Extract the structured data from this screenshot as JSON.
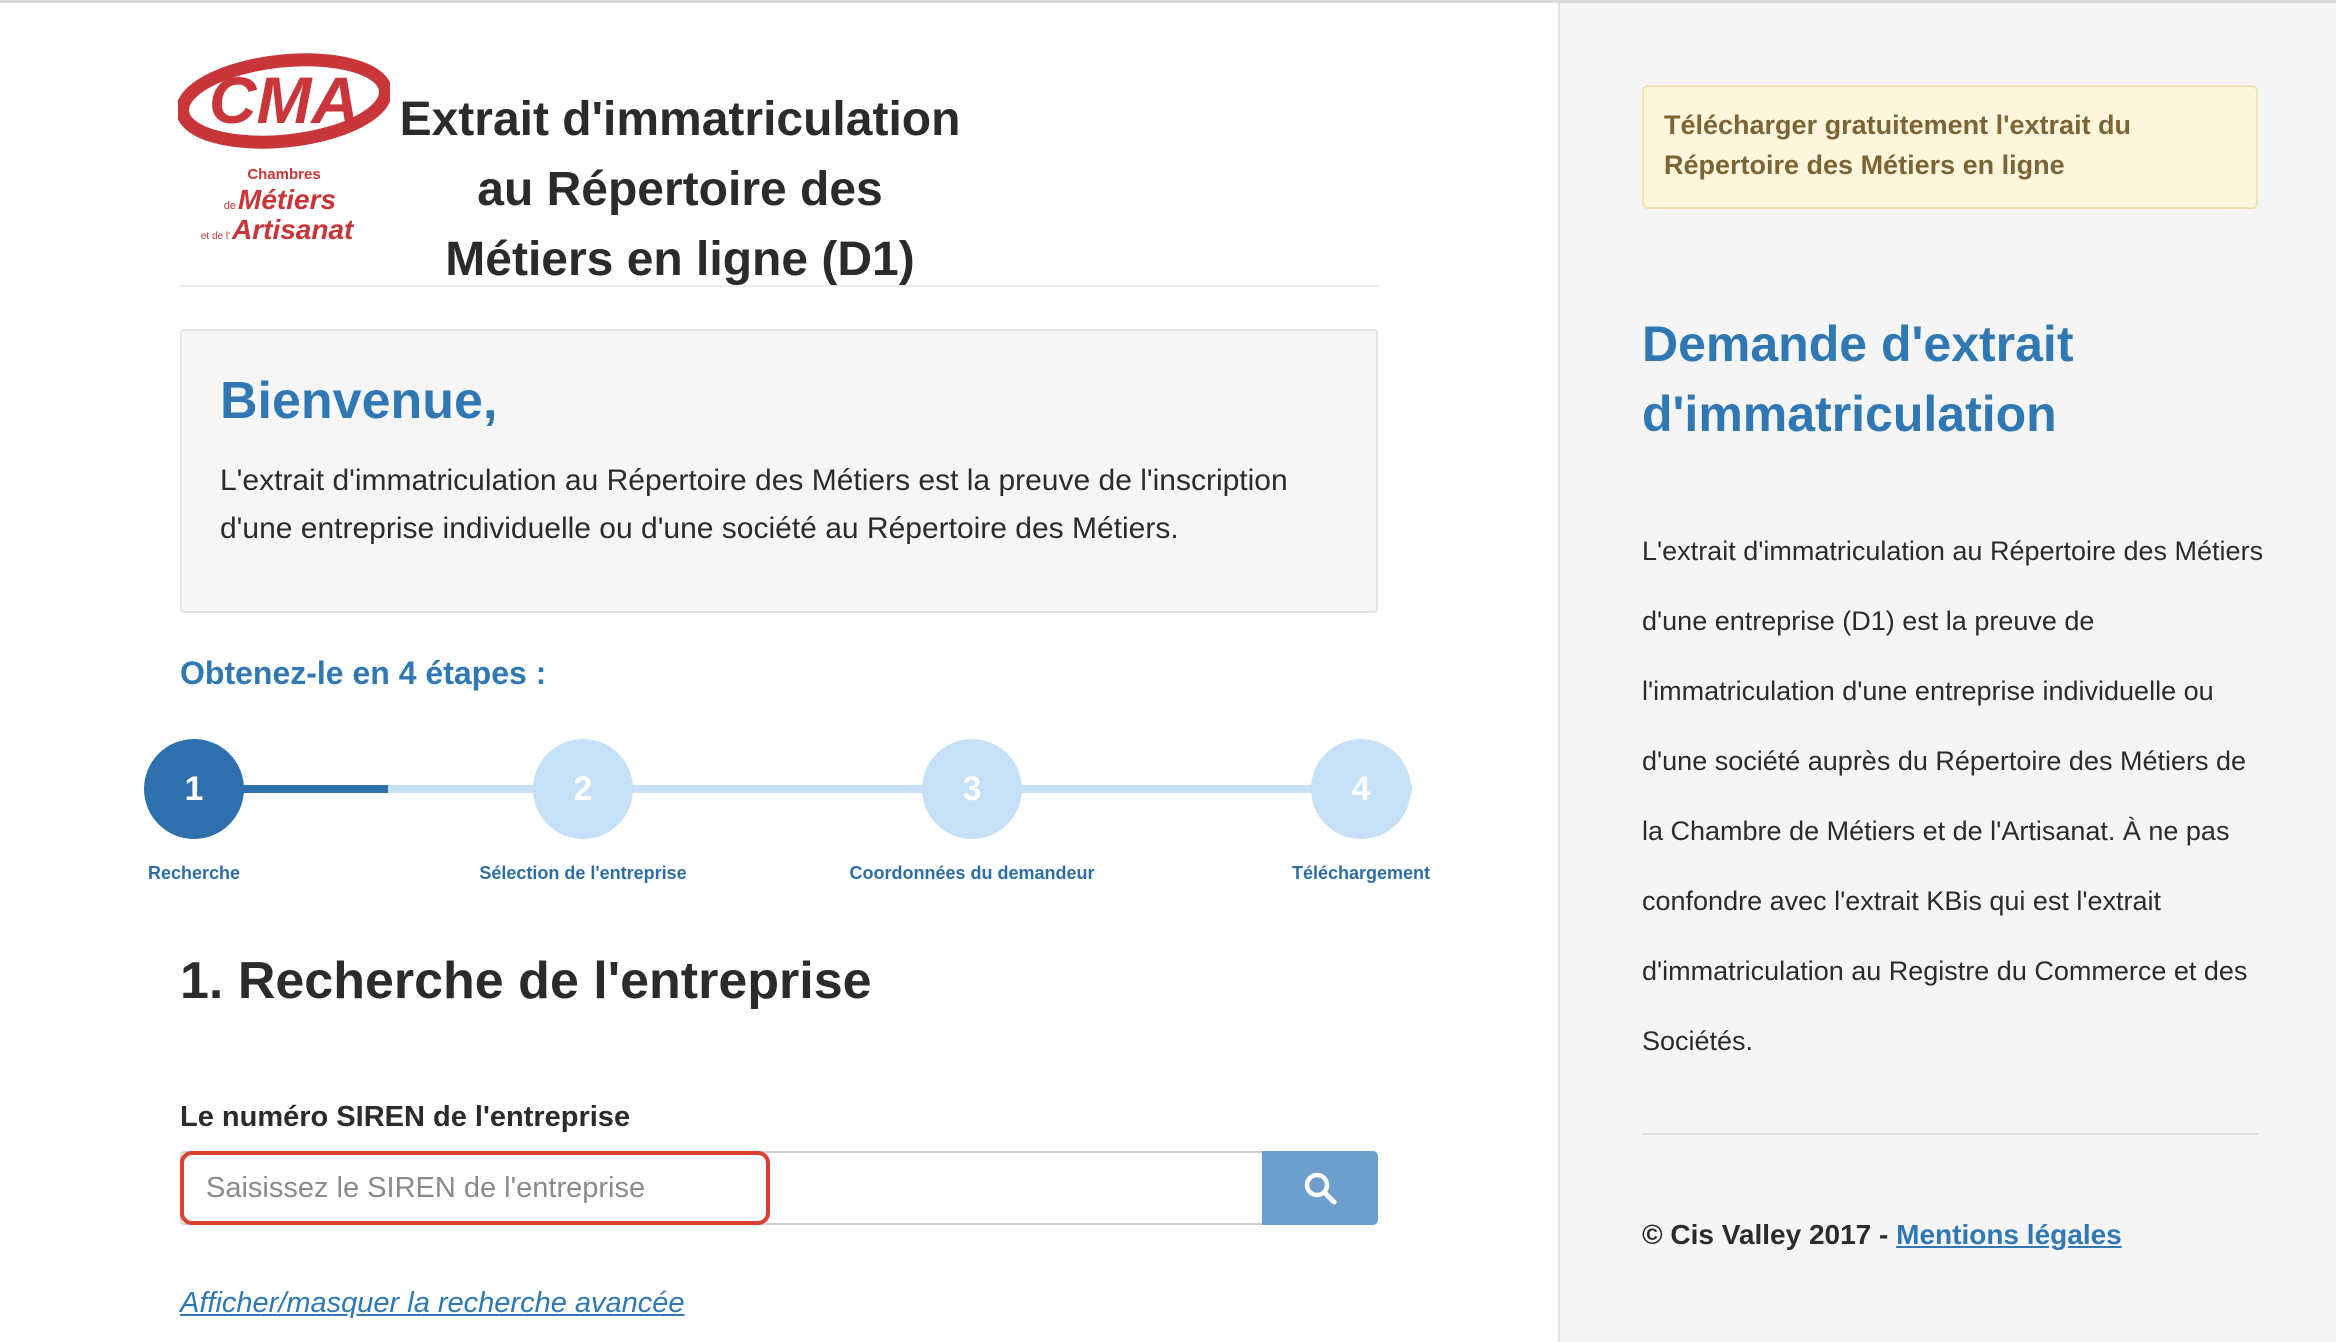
{
  "header": {
    "logo": {
      "brand_letters": "CMA",
      "line1": "Chambres",
      "line2_small": "de",
      "line2": "Métiers",
      "line3_small": "et de l'",
      "line3": "Artisanat",
      "colors": {
        "red": "#c8363a"
      }
    },
    "title": "Extrait d'immatriculation au Répertoire des Métiers en ligne (D1)"
  },
  "welcome": {
    "heading": "Bienvenue,",
    "text": "L'extrait d'immatriculation au Répertoire des Métiers est la preuve de l'inscription d'une entreprise individuelle ou d'une société au Répertoire des Métiers."
  },
  "steps": {
    "heading": "Obtenez-le en 4 étapes :",
    "current": 1,
    "items": [
      {
        "number": "1",
        "label": "Recherche"
      },
      {
        "number": "2",
        "label": "Sélection de l'entreprise"
      },
      {
        "number": "3",
        "label": "Coordonnées du demandeur"
      },
      {
        "number": "4",
        "label": "Téléchargement"
      }
    ]
  },
  "search": {
    "section_title": "1. Recherche de l'entreprise",
    "field_label": "Le numéro SIREN de l'entreprise",
    "placeholder": "Saisissez le SIREN de l'entreprise",
    "value": "",
    "button_icon": "search-icon",
    "advanced_link": "Afficher/masquer la recherche avancée"
  },
  "sidebar": {
    "promo": "Télécharger gratuitement l'extrait du Répertoire des Métiers en ligne",
    "title": "Demande d'extrait d'immatriculation",
    "text": "L'extrait d'immatriculation au Répertoire des Métiers d'une entreprise (D1)  est la preuve de l'immatriculation d'une entreprise individuelle ou d'une société auprès du Répertoire des Métiers de la Chambre de Métiers et de l'Artisanat.  À ne pas confondre avec l'extrait KBis qui est l'extrait d'immatriculation au Registre du Commerce et des Sociétés.",
    "footer_prefix": "© Cis Valley 2017 - ",
    "footer_link": "Mentions légales"
  },
  "colors": {
    "accent": "#2f78b3",
    "step_active": "#2d70ad",
    "step_inactive": "#c6e0f7",
    "search_button": "#6d9fcc",
    "highlight": "#d94030"
  }
}
